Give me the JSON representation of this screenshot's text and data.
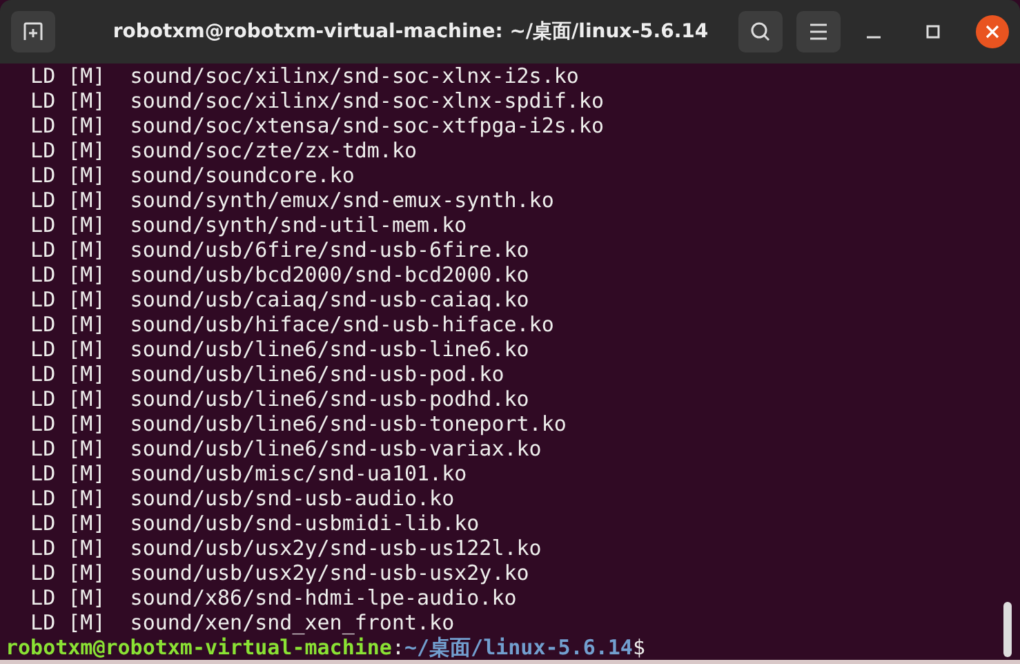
{
  "window": {
    "title": "robotxm@robotxm-virtual-machine: ~/桌面/linux-5.6.14"
  },
  "lines": [
    "  LD [M]  sound/soc/xilinx/snd-soc-xlnx-i2s.ko",
    "  LD [M]  sound/soc/xilinx/snd-soc-xlnx-spdif.ko",
    "  LD [M]  sound/soc/xtensa/snd-soc-xtfpga-i2s.ko",
    "  LD [M]  sound/soc/zte/zx-tdm.ko",
    "  LD [M]  sound/soundcore.ko",
    "  LD [M]  sound/synth/emux/snd-emux-synth.ko",
    "  LD [M]  sound/synth/snd-util-mem.ko",
    "  LD [M]  sound/usb/6fire/snd-usb-6fire.ko",
    "  LD [M]  sound/usb/bcd2000/snd-bcd2000.ko",
    "  LD [M]  sound/usb/caiaq/snd-usb-caiaq.ko",
    "  LD [M]  sound/usb/hiface/snd-usb-hiface.ko",
    "  LD [M]  sound/usb/line6/snd-usb-line6.ko",
    "  LD [M]  sound/usb/line6/snd-usb-pod.ko",
    "  LD [M]  sound/usb/line6/snd-usb-podhd.ko",
    "  LD [M]  sound/usb/line6/snd-usb-toneport.ko",
    "  LD [M]  sound/usb/line6/snd-usb-variax.ko",
    "  LD [M]  sound/usb/misc/snd-ua101.ko",
    "  LD [M]  sound/usb/snd-usb-audio.ko",
    "  LD [M]  sound/usb/snd-usbmidi-lib.ko",
    "  LD [M]  sound/usb/usx2y/snd-usb-us122l.ko",
    "  LD [M]  sound/usb/usx2y/snd-usb-usx2y.ko",
    "  LD [M]  sound/x86/snd-hdmi-lpe-audio.ko",
    "  LD [M]  sound/xen/snd_xen_front.ko"
  ],
  "prompt": {
    "user": "robotxm@robotxm-virtual-machine",
    "separator": ":",
    "path": "~/桌面/linux-5.6.14",
    "symbol": "$"
  }
}
